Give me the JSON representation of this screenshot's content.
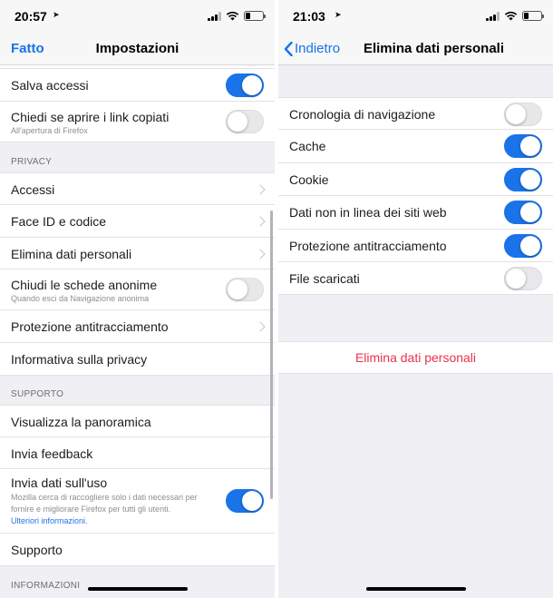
{
  "left": {
    "status": {
      "time": "20:57"
    },
    "nav": {
      "left": "Fatto",
      "title": "Impostazioni"
    },
    "rows": {
      "salva_accessi": "Salva accessi",
      "chiedi_link": "Chiedi se aprire i link copiati",
      "chiedi_link_sub": "All'apertura di Firefox",
      "accessi": "Accessi",
      "face_id": "Face ID e codice",
      "elimina": "Elimina dati personali",
      "chiudi_schede": "Chiudi le schede anonime",
      "chiudi_schede_sub": "Quando esci da Navigazione anonima",
      "protezione": "Protezione antitracciamento",
      "informativa": "Informativa sulla privacy",
      "visualizza": "Visualizza la panoramica",
      "feedback": "Invia feedback",
      "invia_dati": "Invia dati sull'uso",
      "invia_dati_sub": "Mozilla cerca di raccogliere solo i dati necessari per fornire e migliorare Firefox per tutti gli utenti.",
      "invia_dati_link": "Ulteriori informazioni.",
      "supporto": "Supporto"
    },
    "headers": {
      "privacy": "PRIVACY",
      "supporto": "SUPPORTO",
      "informazioni": "INFORMAZIONI"
    },
    "toggles": {
      "salva_accessi": true,
      "chiedi_link": false,
      "chiudi_schede": false,
      "invia_dati": true
    }
  },
  "right": {
    "status": {
      "time": "21:03"
    },
    "nav": {
      "back": "Indietro",
      "title": "Elimina dati personali"
    },
    "items": [
      {
        "label": "Cronologia di navigazione",
        "on": false
      },
      {
        "label": "Cache",
        "on": true
      },
      {
        "label": "Cookie",
        "on": true
      },
      {
        "label": "Dati non in linea dei siti web",
        "on": true
      },
      {
        "label": "Protezione antitracciamento",
        "on": true
      },
      {
        "label": "File scaricati",
        "on": false
      }
    ],
    "action": "Elimina dati personali"
  },
  "colors": {
    "accent": "#1a73e8",
    "destructive": "#e8334a"
  },
  "icons": [
    "location-arrow-icon",
    "cellular-signal-icon",
    "wifi-icon",
    "battery-icon",
    "chevron-right-icon",
    "chevron-left-icon"
  ]
}
